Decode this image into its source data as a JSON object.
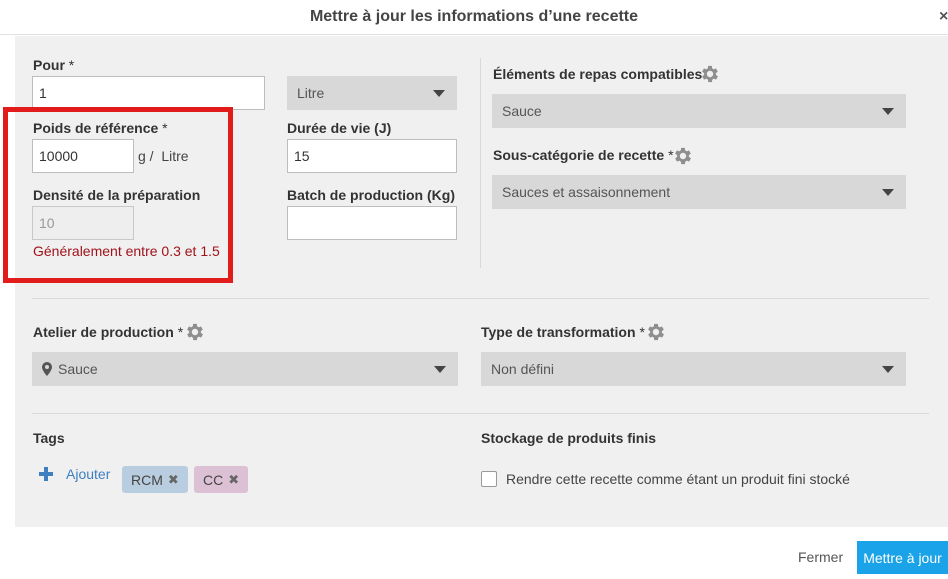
{
  "dialog": {
    "title": "Mettre à jour les informations d’une recette",
    "close_glyph": "×"
  },
  "form": {
    "pour": {
      "label": "Pour",
      "required_mark": "*",
      "value": "1"
    },
    "unit_select": {
      "value": "Litre"
    },
    "poids_reference": {
      "label": "Poids de référence",
      "required_mark": "*",
      "value": "10000",
      "unit_suffix": "g /  Litre"
    },
    "duree_vie": {
      "label": "Durée de vie (J)",
      "value": "15"
    },
    "densite": {
      "label": "Densité de la préparation",
      "value": "10",
      "hint": "Généralement entre 0.3 et 1.5"
    },
    "batch": {
      "label": "Batch de production (Kg)",
      "value": ""
    },
    "elements_repas": {
      "label": "Éléments de repas compatibles",
      "value": "Sauce"
    },
    "sous_categorie": {
      "label": "Sous-catégorie de recette",
      "required_mark": "*",
      "value": "Sauces et assaisonnement"
    },
    "atelier": {
      "label": "Atelier de production",
      "required_mark": "*",
      "value": "Sauce"
    },
    "type_transformation": {
      "label": "Type de transformation",
      "required_mark": "*",
      "value": "Non défini"
    },
    "tags": {
      "label": "Tags",
      "add_label": "Ajouter",
      "items": [
        {
          "name": "RCM",
          "color": "#b9cde0",
          "remove_glyph": "✖"
        },
        {
          "name": "CC",
          "color": "#dcc0d4",
          "remove_glyph": "✖"
        }
      ]
    },
    "stockage": {
      "label": "Stockage de produits finis",
      "checkbox_label": "Rendre cette recette comme étant un produit fini stocké",
      "checked": false
    }
  },
  "footer": {
    "cancel_label": "Fermer",
    "submit_label": "Mettre à jour"
  },
  "colors": {
    "accent": "#1aa3e8",
    "hint": "#a0121a",
    "highlight": "#e21b1b",
    "link": "#3f7fc0"
  },
  "icons": {
    "gear": "gear-icon",
    "caret": "caret-down-icon",
    "pin": "map-pin-icon",
    "plus": "plus-icon",
    "remove": "remove-icon"
  }
}
